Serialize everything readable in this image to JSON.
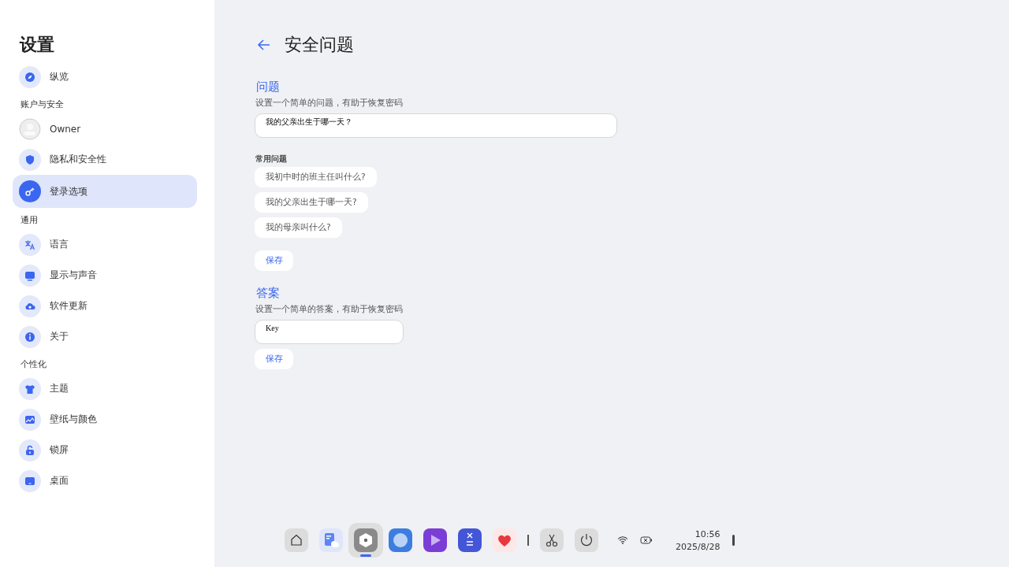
{
  "sidebar": {
    "title": "设置",
    "items": [
      {
        "kind": "item",
        "label": "纵览",
        "selected": false
      },
      {
        "kind": "section",
        "label": "账户与安全"
      },
      {
        "kind": "user",
        "label": "Owner",
        "selected": false
      },
      {
        "kind": "item",
        "label": "隐私和安全性",
        "selected": false
      },
      {
        "kind": "item",
        "label": "登录选项",
        "selected": true
      },
      {
        "kind": "section",
        "label": "通用"
      },
      {
        "kind": "item",
        "label": "语言",
        "selected": false
      },
      {
        "kind": "item",
        "label": "显示与声音",
        "selected": false
      },
      {
        "kind": "item",
        "label": "软件更新",
        "selected": false
      },
      {
        "kind": "item",
        "label": "关于",
        "selected": false
      },
      {
        "kind": "section",
        "label": "个性化"
      },
      {
        "kind": "item",
        "label": "主题",
        "selected": false
      },
      {
        "kind": "item",
        "label": "壁纸与颜色",
        "selected": false
      },
      {
        "kind": "item",
        "label": "锁屏",
        "selected": false
      },
      {
        "kind": "item",
        "label": "桌面",
        "selected": false
      }
    ]
  },
  "page": {
    "title": "安全问题",
    "question": {
      "heading": "问题",
      "description": "设置一个简单的问题，有助于恢复密码",
      "value": "我的父亲出生于哪一天？",
      "common_heading": "常用问题",
      "common": [
        "我初中时的班主任叫什么?",
        "我的父亲出生于哪一天?",
        "我的母亲叫什么?"
      ],
      "save": "保存"
    },
    "answer": {
      "heading": "答案",
      "description": "设置一个简单的答案，有助于恢复密码",
      "value": "Key",
      "save": "保存"
    }
  },
  "taskbar": {
    "apps": [
      {
        "selected": false
      },
      {
        "selected": false
      },
      {
        "selected": true
      },
      {
        "selected": false
      },
      {
        "selected": false
      },
      {
        "selected": false
      },
      {
        "selected": false
      }
    ],
    "tools": [
      {
        "selected": false
      },
      {
        "selected": false
      }
    ],
    "time": "10:56",
    "date": "2025/8/28"
  }
}
